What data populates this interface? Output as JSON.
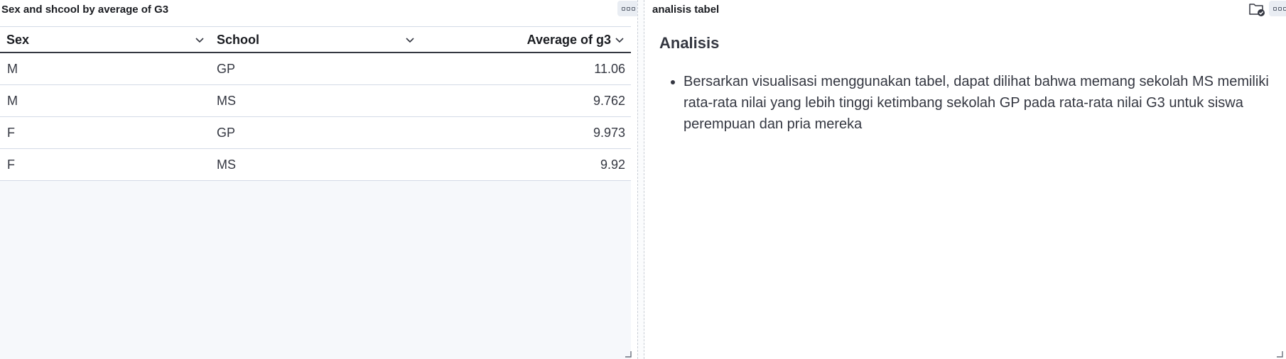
{
  "left_panel": {
    "title": "Sex and shcool by average of G3",
    "columns": [
      "Sex",
      "School",
      "Average of g3"
    ],
    "rows": [
      {
        "sex": "M",
        "school": "GP",
        "avg": "11.06"
      },
      {
        "sex": "M",
        "school": "MS",
        "avg": "9.762"
      },
      {
        "sex": "F",
        "school": "GP",
        "avg": "9.973"
      },
      {
        "sex": "F",
        "school": "MS",
        "avg": "9.92"
      }
    ]
  },
  "right_panel": {
    "title": "analisis tabel",
    "heading": "Analisis",
    "bullets": [
      "Bersarkan visualisasi menggunakan tabel, dapat dilihat bahwa memang sekolah MS memiliki rata-rata nilai yang lebih tinggi ketimbang sekolah GP pada rata-rata nilai G3 untuk siswa perempuan dan pria mereka"
    ]
  },
  "icons": {
    "panel_menu": "panel-options-icon",
    "sort": "chevron-down-icon",
    "folder": "folder-check-icon",
    "resize": "resize-handle-icon"
  },
  "colors": {
    "header_border": "#343741",
    "row_border": "#d3dae6",
    "empty_area": "#f6f8fb",
    "text": "#343741"
  }
}
